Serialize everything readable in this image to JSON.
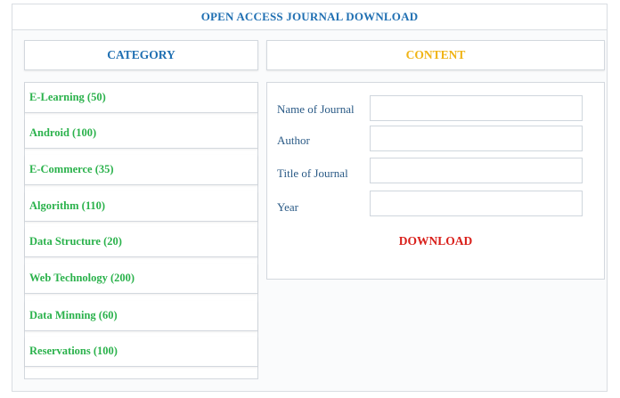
{
  "header": {
    "title": "OPEN ACCESS JOURNAL DOWNLOAD"
  },
  "category": {
    "heading": "CATEGORY",
    "items": [
      {
        "label": "E-Learning (50)"
      },
      {
        "label": "Android (100)"
      },
      {
        "label": "E-Commerce (35)"
      },
      {
        "label": "Algorithm (110)"
      },
      {
        "label": "Data Structure (20)"
      },
      {
        "label": "Web Technology (200)"
      },
      {
        "label": "Data Minning (60)"
      },
      {
        "label": "Reservations (100)"
      }
    ]
  },
  "content": {
    "heading": "CONTENT",
    "fields": [
      {
        "label": "Name of Journal",
        "value": ""
      },
      {
        "label": "Author",
        "value": ""
      },
      {
        "label": "Title of Journal",
        "value": ""
      },
      {
        "label": "Year",
        "value": ""
      }
    ],
    "download_label": "DOWNLOAD"
  },
  "colors": {
    "title_blue": "#1f6fb2",
    "category_green": "#2bb24c",
    "content_yellow": "#f0b417",
    "download_red": "#d9201b"
  }
}
